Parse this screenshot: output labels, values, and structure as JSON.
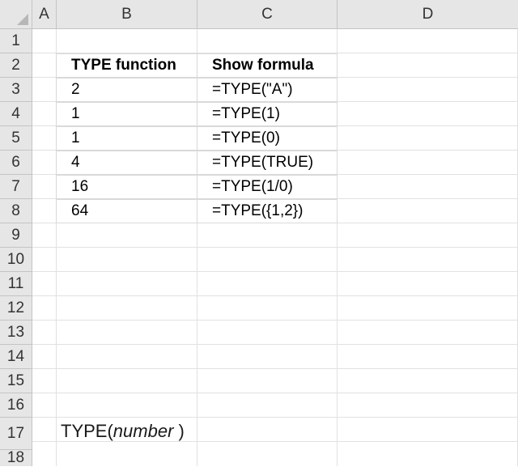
{
  "columns": [
    "A",
    "B",
    "C",
    "D"
  ],
  "rows": [
    "1",
    "2",
    "3",
    "4",
    "5",
    "6",
    "7",
    "8",
    "9",
    "10",
    "11",
    "12",
    "13",
    "14",
    "15",
    "16",
    "17",
    "18"
  ],
  "table": {
    "headers": [
      "TYPE function",
      "Show formula"
    ],
    "rows": [
      [
        "2",
        "=TYPE(\"A\")"
      ],
      [
        "1",
        "=TYPE(1)"
      ],
      [
        "1",
        "=TYPE(0)"
      ],
      [
        "4",
        "=TYPE(TRUE)"
      ],
      [
        "16",
        "=TYPE(1/0)"
      ],
      [
        "64",
        "=TYPE({1,2})"
      ]
    ]
  },
  "syntax": {
    "func": "TYPE(",
    "arg": "number ",
    "close": ")"
  }
}
